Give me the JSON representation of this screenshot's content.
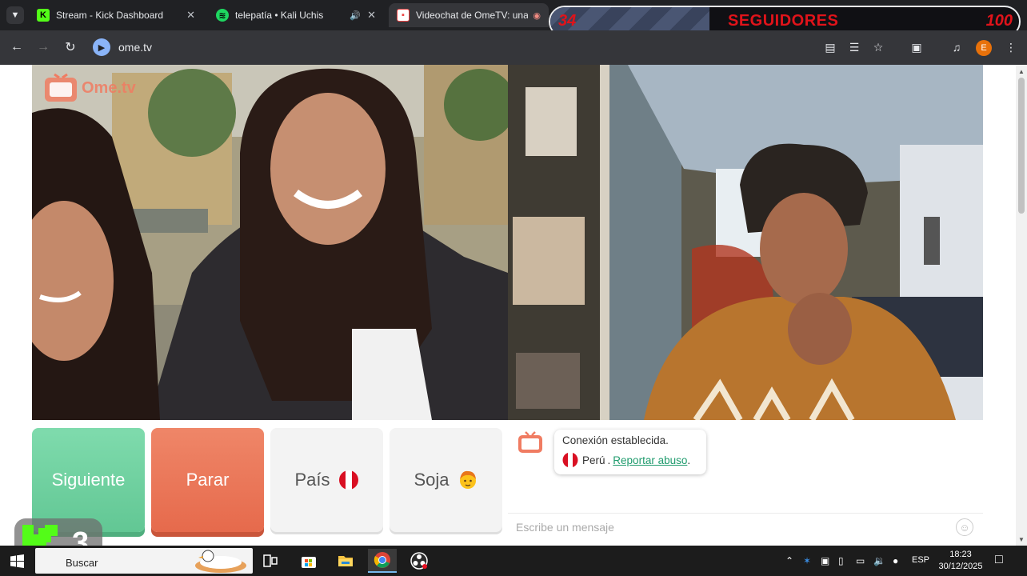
{
  "browser": {
    "tabs": [
      {
        "title": "Stream - Kick Dashboard",
        "favicon": "kick-logo"
      },
      {
        "title": "telepatía • Kali Uchis",
        "favicon": "spotify-logo",
        "audio": true
      },
      {
        "title": "Videochat de OmeTV: una",
        "favicon": "ometv-logo",
        "active": true
      }
    ],
    "url": "ome.tv",
    "profile_initial": "E"
  },
  "overlay": {
    "current": "34",
    "label": "SEGUIDORES",
    "goal": "100",
    "progress": 0.34,
    "text_color": "#e0131a"
  },
  "page": {
    "logo_text": "Ome.tv",
    "logo_badge": "Ome\ntv",
    "controls": {
      "next_label": "Siguiente",
      "stop_label": "Parar",
      "country_label": "País",
      "gender_label": "Soja"
    },
    "chat": {
      "status": "Conexión establecida.",
      "country": "Perú",
      "separator": ".",
      "report_link": "Reportar abuso",
      "report_suffix": ".",
      "message_placeholder": "Escribe un mensaje"
    },
    "colors": {
      "next": "#6fd3a2",
      "stop": "#ea7657",
      "link": "#1f9b6d"
    }
  },
  "kick_overlay": {
    "count": "3"
  },
  "taskbar": {
    "search_label": "Buscar",
    "language": "ESP",
    "time": "18:23",
    "date": "30/12/2025"
  }
}
